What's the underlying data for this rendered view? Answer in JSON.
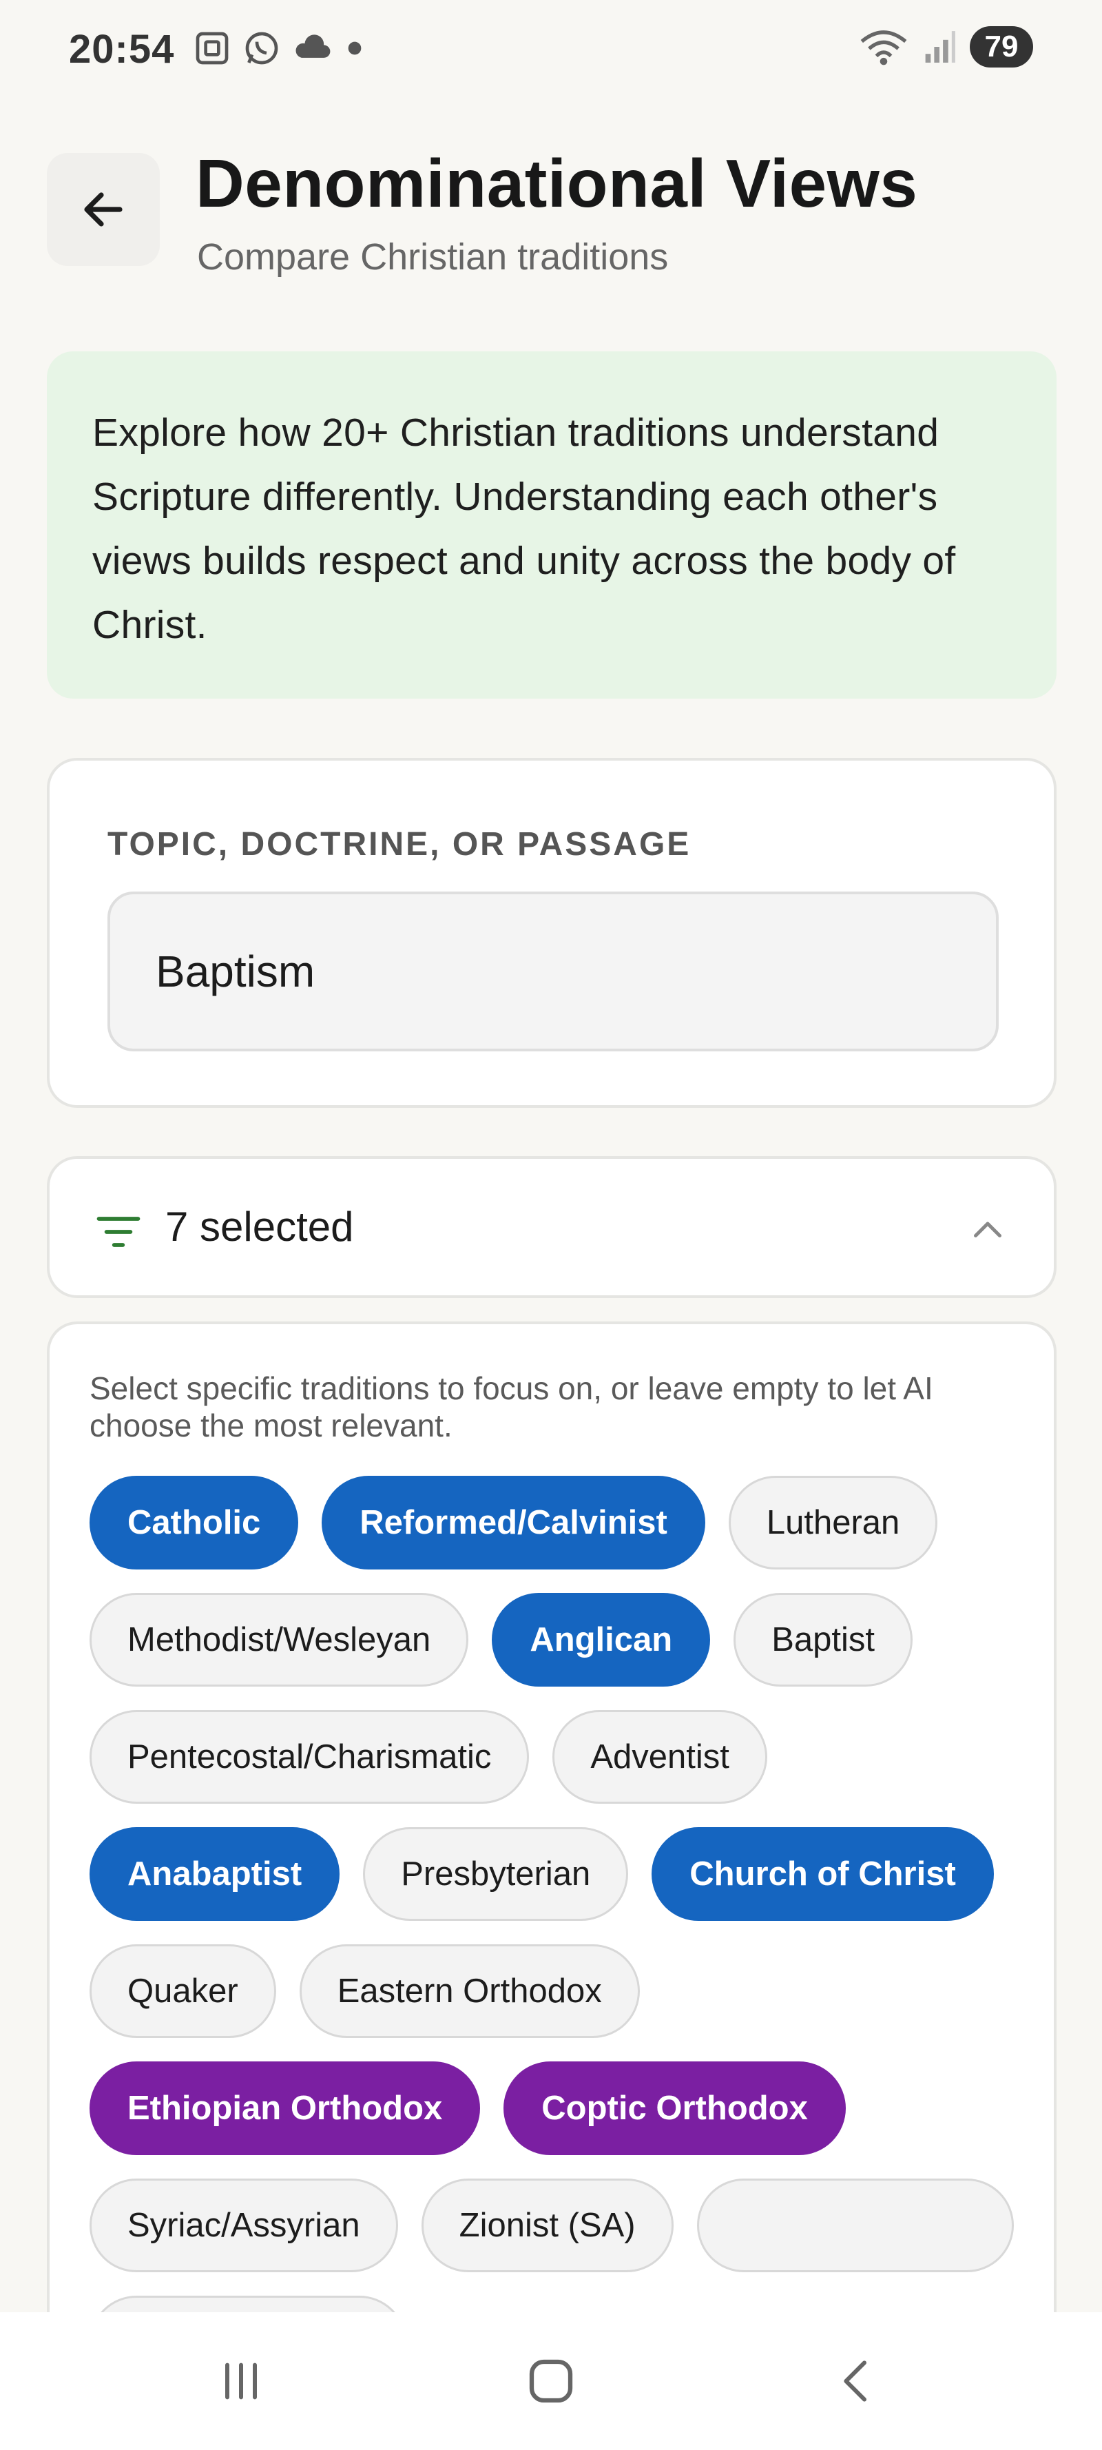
{
  "status_bar": {
    "time": "20:54",
    "battery": "79",
    "left_icons": [
      "screenshot-icon",
      "whatsapp-icon",
      "cloud-icon",
      "dot-icon"
    ],
    "right_icons": [
      "wifi-icon",
      "signal-icon"
    ]
  },
  "header": {
    "title": "Denominational Views",
    "subtitle": "Compare Christian traditions",
    "back_icon": "arrow-left-icon"
  },
  "intro": {
    "text": "Explore how 20+ Christian traditions understand Scripture differently. Understanding each other's views builds respect and unity across the body of Christ."
  },
  "topic": {
    "label": "TOPIC, DOCTRINE, OR PASSAGE",
    "value": "Baptism"
  },
  "filter": {
    "label": "7 selected",
    "icon": "filter-icon",
    "toggle_icon": "chevron-up-icon"
  },
  "traditions": {
    "helper": "Select specific traditions to focus on, or leave empty to let AI choose the most relevant.",
    "items": [
      {
        "label": "Catholic",
        "state": "selected-blue"
      },
      {
        "label": "Reformed/Calvinist",
        "state": "selected-blue"
      },
      {
        "label": "Lutheran",
        "state": "unselected"
      },
      {
        "label": "Methodist/Wesleyan",
        "state": "unselected"
      },
      {
        "label": "Anglican",
        "state": "selected-blue"
      },
      {
        "label": "Baptist",
        "state": "unselected"
      },
      {
        "label": "Pentecostal/Charismatic",
        "state": "unselected"
      },
      {
        "label": "Adventist",
        "state": "unselected"
      },
      {
        "label": "Anabaptist",
        "state": "selected-blue"
      },
      {
        "label": "Presbyterian",
        "state": "unselected"
      },
      {
        "label": "Church of Christ",
        "state": "selected-blue"
      },
      {
        "label": "Quaker",
        "state": "unselected"
      },
      {
        "label": "Eastern Orthodox",
        "state": "unselected"
      },
      {
        "label": "Ethiopian Orthodox",
        "state": "selected-purple"
      },
      {
        "label": "Coptic Orthodox",
        "state": "selected-purple"
      },
      {
        "label": "Syriac/Assyrian",
        "state": "unselected"
      },
      {
        "label": "Zionist (SA)",
        "state": "unselected"
      }
    ]
  },
  "colors": {
    "background": "#f8f7f3",
    "intro_bg": "#e7f5e6",
    "chip_blue": "#1565c0",
    "chip_purple": "#7b1fa2",
    "filter_icon": "#2e7d32"
  },
  "nav": {
    "recents_icon": "recents-icon",
    "home_icon": "home-icon",
    "back_icon": "nav-back-icon"
  }
}
